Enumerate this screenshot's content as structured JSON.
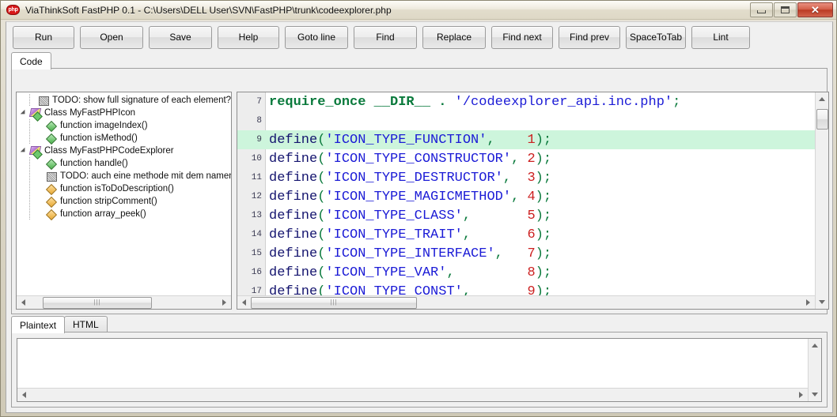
{
  "window": {
    "title": "ViaThinkSoft FastPHP 0.1 - C:\\Users\\DELL User\\SVN\\FastPHP\\trunk\\codeexplorer.php",
    "app_icon": "php-icon",
    "icon_label": "php",
    "controls": {
      "minimize": "minimize-icon",
      "restore": "restore-icon",
      "close": "✕"
    }
  },
  "toolbar": {
    "buttons": [
      {
        "label": "Run",
        "name": "run-button"
      },
      {
        "label": "Open",
        "name": "open-button"
      },
      {
        "label": "Save",
        "name": "save-button"
      },
      {
        "label": "Help",
        "name": "help-button"
      },
      {
        "label": "Goto line",
        "name": "goto-line-button"
      },
      {
        "label": "Find",
        "name": "find-button"
      },
      {
        "label": "Replace",
        "name": "replace-button"
      },
      {
        "label": "Find next",
        "name": "find-next-button"
      },
      {
        "label": "Find prev",
        "name": "find-prev-button"
      },
      {
        "label": "SpaceToTab",
        "name": "space-to-tab-button"
      },
      {
        "label": "Lint",
        "name": "lint-button"
      }
    ]
  },
  "top_tabs": {
    "items": [
      {
        "label": "Code",
        "active": true
      }
    ]
  },
  "tree": {
    "rows": [
      {
        "label": "TODO: show full signature of each element?",
        "icon": "todo-icon",
        "depth": 1,
        "expander": false
      },
      {
        "label": "Class MyFastPHPIcon",
        "icon": "class-icon",
        "depth": 0,
        "expander": true
      },
      {
        "label": "function imageIndex()",
        "icon": "function-green-icon",
        "depth": 2,
        "expander": false
      },
      {
        "label": "function isMethod()",
        "icon": "function-green-icon",
        "depth": 2,
        "expander": false
      },
      {
        "label": "Class MyFastPHPCodeExplorer",
        "icon": "class-icon",
        "depth": 0,
        "expander": true
      },
      {
        "label": "function handle()",
        "icon": "function-green-icon",
        "depth": 2,
        "expander": false
      },
      {
        "label": "TODO: auch eine methode mit dem namen c",
        "icon": "todo-icon",
        "depth": 2,
        "expander": false
      },
      {
        "label": "function isToDoDescription()",
        "icon": "function-orange-icon",
        "depth": 2,
        "expander": false
      },
      {
        "label": "function stripComment()",
        "icon": "function-orange-icon",
        "depth": 2,
        "expander": false
      },
      {
        "label": "function array_peek()",
        "icon": "function-orange-icon",
        "depth": 2,
        "expander": false
      }
    ]
  },
  "editor": {
    "highlight_line": 9,
    "highlight_color": "#cdf5dc",
    "lines": [
      {
        "n": "7",
        "tokens": [
          {
            "t": "kw",
            "v": "require_once"
          },
          {
            "t": "pl",
            "v": " "
          },
          {
            "t": "kw",
            "v": "__DIR__"
          },
          {
            "t": "pl",
            "v": " "
          },
          {
            "t": "op",
            "v": "."
          },
          {
            "t": "pl",
            "v": " "
          },
          {
            "t": "str",
            "v": "'/codeexplorer_api.inc.php'"
          },
          {
            "t": "pun",
            "v": ";"
          }
        ]
      },
      {
        "n": "8",
        "tokens": []
      },
      {
        "n": "9",
        "tokens": [
          {
            "t": "fn",
            "v": "define"
          },
          {
            "t": "pun",
            "v": "("
          },
          {
            "t": "str",
            "v": "'ICON_TYPE_FUNCTION'"
          },
          {
            "t": "pun",
            "v": ","
          },
          {
            "t": "pl",
            "v": "    "
          },
          {
            "t": "num",
            "v": "1"
          },
          {
            "t": "pun",
            "v": ");"
          }
        ]
      },
      {
        "n": "10",
        "tokens": [
          {
            "t": "fn",
            "v": "define"
          },
          {
            "t": "pun",
            "v": "("
          },
          {
            "t": "str",
            "v": "'ICON_TYPE_CONSTRUCTOR'"
          },
          {
            "t": "pun",
            "v": ","
          },
          {
            "t": "pl",
            "v": " "
          },
          {
            "t": "num",
            "v": "2"
          },
          {
            "t": "pun",
            "v": ");"
          }
        ]
      },
      {
        "n": "11",
        "tokens": [
          {
            "t": "fn",
            "v": "define"
          },
          {
            "t": "pun",
            "v": "("
          },
          {
            "t": "str",
            "v": "'ICON_TYPE_DESTRUCTOR'"
          },
          {
            "t": "pun",
            "v": ","
          },
          {
            "t": "pl",
            "v": "  "
          },
          {
            "t": "num",
            "v": "3"
          },
          {
            "t": "pun",
            "v": ");"
          }
        ]
      },
      {
        "n": "12",
        "tokens": [
          {
            "t": "fn",
            "v": "define"
          },
          {
            "t": "pun",
            "v": "("
          },
          {
            "t": "str",
            "v": "'ICON_TYPE_MAGICMETHOD'"
          },
          {
            "t": "pun",
            "v": ","
          },
          {
            "t": "pl",
            "v": " "
          },
          {
            "t": "num",
            "v": "4"
          },
          {
            "t": "pun",
            "v": ");"
          }
        ]
      },
      {
        "n": "13",
        "tokens": [
          {
            "t": "fn",
            "v": "define"
          },
          {
            "t": "pun",
            "v": "("
          },
          {
            "t": "str",
            "v": "'ICON_TYPE_CLASS'"
          },
          {
            "t": "pun",
            "v": ","
          },
          {
            "t": "pl",
            "v": "       "
          },
          {
            "t": "num",
            "v": "5"
          },
          {
            "t": "pun",
            "v": ");"
          }
        ]
      },
      {
        "n": "14",
        "tokens": [
          {
            "t": "fn",
            "v": "define"
          },
          {
            "t": "pun",
            "v": "("
          },
          {
            "t": "str",
            "v": "'ICON_TYPE_TRAIT'"
          },
          {
            "t": "pun",
            "v": ","
          },
          {
            "t": "pl",
            "v": "       "
          },
          {
            "t": "num",
            "v": "6"
          },
          {
            "t": "pun",
            "v": ");"
          }
        ]
      },
      {
        "n": "15",
        "tokens": [
          {
            "t": "fn",
            "v": "define"
          },
          {
            "t": "pun",
            "v": "("
          },
          {
            "t": "str",
            "v": "'ICON_TYPE_INTERFACE'"
          },
          {
            "t": "pun",
            "v": ","
          },
          {
            "t": "pl",
            "v": "   "
          },
          {
            "t": "num",
            "v": "7"
          },
          {
            "t": "pun",
            "v": ");"
          }
        ]
      },
      {
        "n": "16",
        "tokens": [
          {
            "t": "fn",
            "v": "define"
          },
          {
            "t": "pun",
            "v": "("
          },
          {
            "t": "str",
            "v": "'ICON_TYPE_VAR'"
          },
          {
            "t": "pun",
            "v": ","
          },
          {
            "t": "pl",
            "v": "         "
          },
          {
            "t": "num",
            "v": "8"
          },
          {
            "t": "pun",
            "v": ");"
          }
        ]
      },
      {
        "n": "17",
        "tokens": [
          {
            "t": "fn",
            "v": "define"
          },
          {
            "t": "pun",
            "v": "("
          },
          {
            "t": "str",
            "v": "'ICON_TYPE_CONST'"
          },
          {
            "t": "pun",
            "v": ","
          },
          {
            "t": "pl",
            "v": "       "
          },
          {
            "t": "num",
            "v": "9"
          },
          {
            "t": "pun",
            "v": ");"
          }
        ]
      }
    ]
  },
  "bottom_tabs": {
    "items": [
      {
        "label": "Plaintext",
        "active": true
      },
      {
        "label": "HTML",
        "active": false
      }
    ]
  },
  "output": {
    "text": ""
  },
  "colors": {
    "keyword": "#0a7a3c",
    "string": "#1b1bd6",
    "number": "#cc2020",
    "function": "#13136e",
    "highlight": "#cdf5dc",
    "frame": "#dcd7c7",
    "close_button": "#bb3a24"
  }
}
